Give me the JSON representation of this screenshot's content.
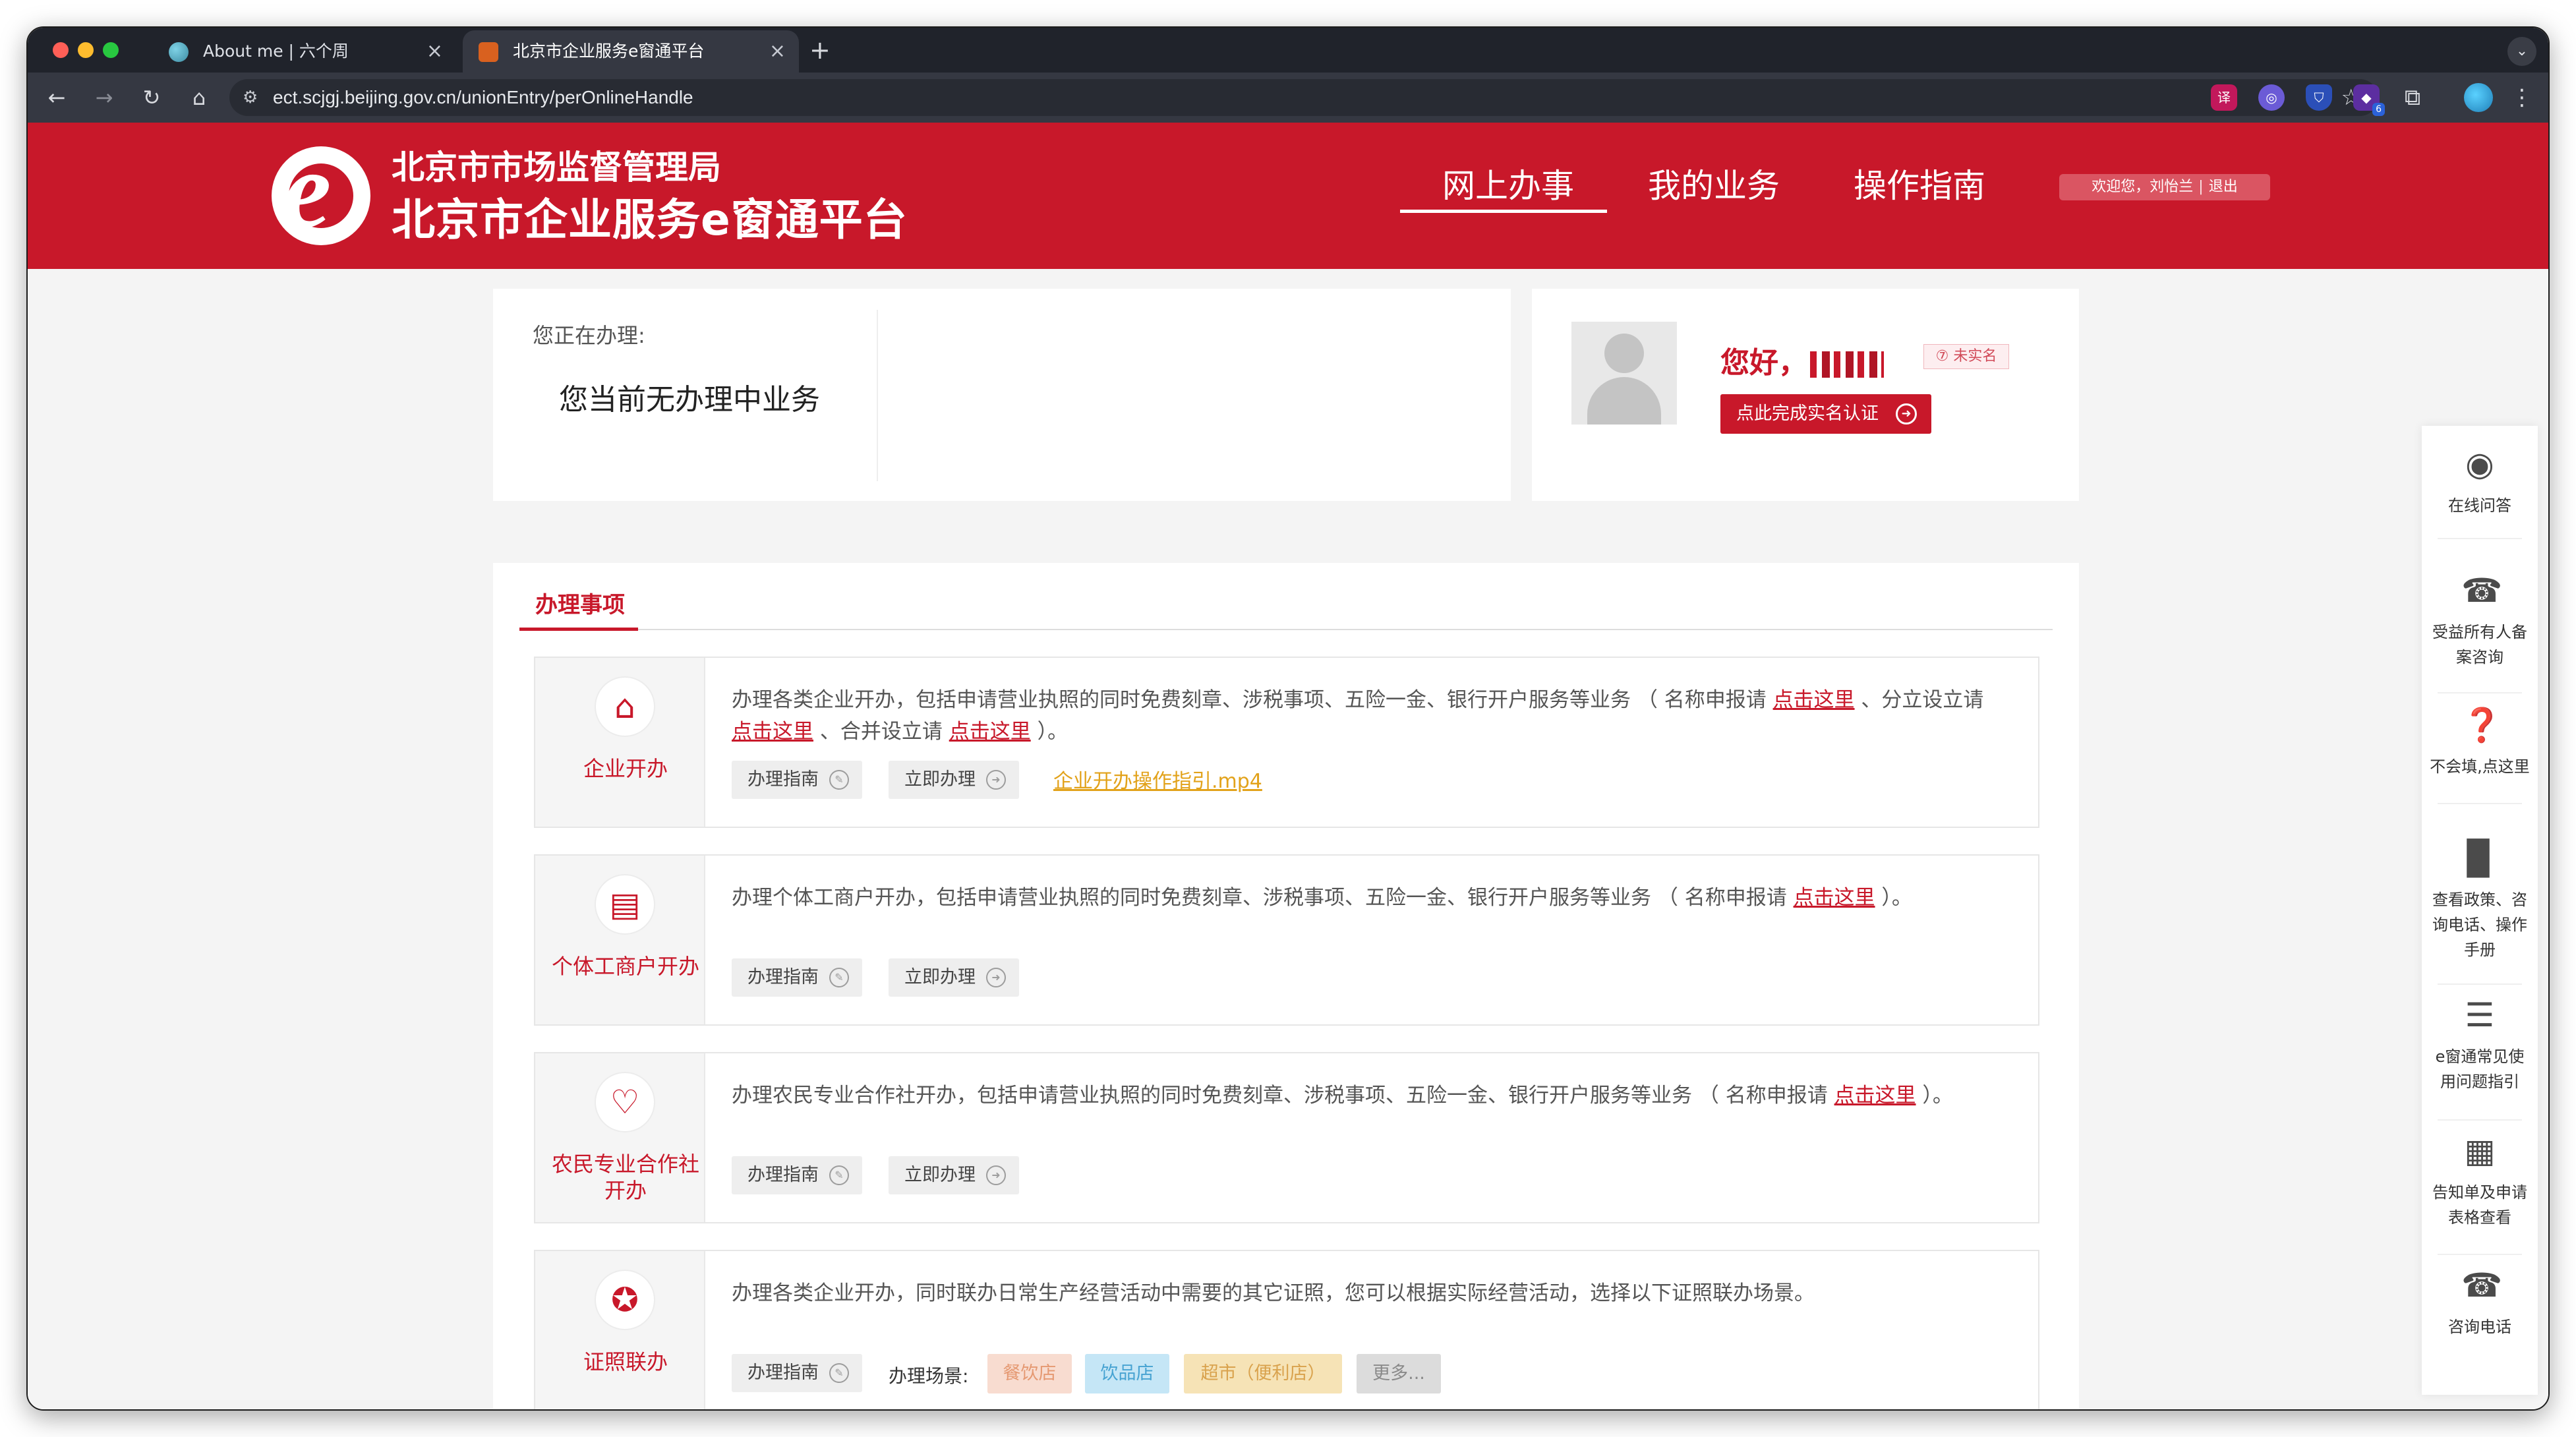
{
  "browser": {
    "tabs": [
      {
        "label": "About me | 六个周"
      },
      {
        "label": "北京市企业服务e窗通平台"
      }
    ],
    "new_tab": "+",
    "menu_glyph": "⌄",
    "url": "ect.scjgj.beijing.gov.cn/unionEntry/perOnlineHandle",
    "extension_badge": "6"
  },
  "header": {
    "logo_letter": "e",
    "subtitle": "北京市市场监督管理局",
    "title": "北京市企业服务e窗通平台",
    "nav": [
      "网上办事",
      "我的业务",
      "操作指南"
    ],
    "active_nav": "网上办事",
    "welcome": "欢迎您，刘怡兰",
    "divider": "|",
    "logout": "退出",
    "brand_color": "#c8182a"
  },
  "current": {
    "label": "您正在办理:",
    "value": "您当前无办理中业务"
  },
  "profile": {
    "greeting": "您好，",
    "badge": "⑦ 未实名",
    "verify_button": "点此完成实名认证"
  },
  "matters": {
    "tab_label": "办理事项",
    "services": [
      {
        "name": "企业开办",
        "icon": "house-up-icon",
        "description_parts": [
          {
            "text": "办理各类企业开办，包括申请营业执照的同时免费刻章、涉税事项、五险一金、银行开户服务等业务 （ 名称申报请 ",
            "link": false
          },
          {
            "text": "点击这里",
            "link": true
          },
          {
            "text": " 、分立设立请 ",
            "link": false
          },
          {
            "text": "点击这里",
            "link": true
          },
          {
            "text": " 、合并设立请 ",
            "link": false
          },
          {
            "text": "点击这里",
            "link": true
          },
          {
            "text": " ）。",
            "link": false
          }
        ],
        "guide": "办理指南",
        "apply": "立即办理",
        "video": "企业开办操作指引.mp4"
      },
      {
        "name": "个体工商户开办",
        "icon": "id-card-icon",
        "description_parts": [
          {
            "text": "办理个体工商户开办，包括申请营业执照的同时免费刻章、涉税事项、五险一金、银行开户服务等业务 （ 名称申报请 ",
            "link": false
          },
          {
            "text": "点击这里",
            "link": true
          },
          {
            "text": " ）。",
            "link": false
          }
        ],
        "guide": "办理指南",
        "apply": "立即办理"
      },
      {
        "name": "农民专业合作社开办",
        "icon": "home-heart-icon",
        "description_parts": [
          {
            "text": "办理农民专业合作社开办，包括申请营业执照的同时免费刻章、涉税事项、五险一金、银行开户服务等业务 （ 名称申报请 ",
            "link": false
          },
          {
            "text": "点击这里",
            "link": true
          },
          {
            "text": " ）。",
            "link": false
          }
        ],
        "guide": "办理指南",
        "apply": "立即办理"
      },
      {
        "name": "证照联办",
        "icon": "certificate-icon",
        "description_parts": [
          {
            "text": "办理各类企业开办，同时联办日常生产经营活动中需要的其它证照，您可以根据实际经营活动，选择以下证照联办场景。",
            "link": false
          }
        ],
        "guide": "办理指南",
        "scene_label": "办理场景:",
        "scenes": [
          "餐饮店",
          "饮品店",
          "超市（便利店）",
          "更多..."
        ]
      }
    ]
  },
  "dock": [
    {
      "label": "在线问答",
      "icon": "chat-robot-icon"
    },
    {
      "label": "受益所有人备案咨询",
      "icon": "phone-icon"
    },
    {
      "label": "不会填,点这里",
      "icon": "question-icon"
    },
    {
      "label": "查看政策、咨询电话、操作手册",
      "icon": "book-icon"
    },
    {
      "label": "e窗通常见使用问题指引",
      "icon": "list-icon"
    },
    {
      "label": "告知单及申请表格查看",
      "icon": "qr-grid-icon"
    },
    {
      "label": "咨询电话",
      "icon": "phone-icon"
    }
  ]
}
